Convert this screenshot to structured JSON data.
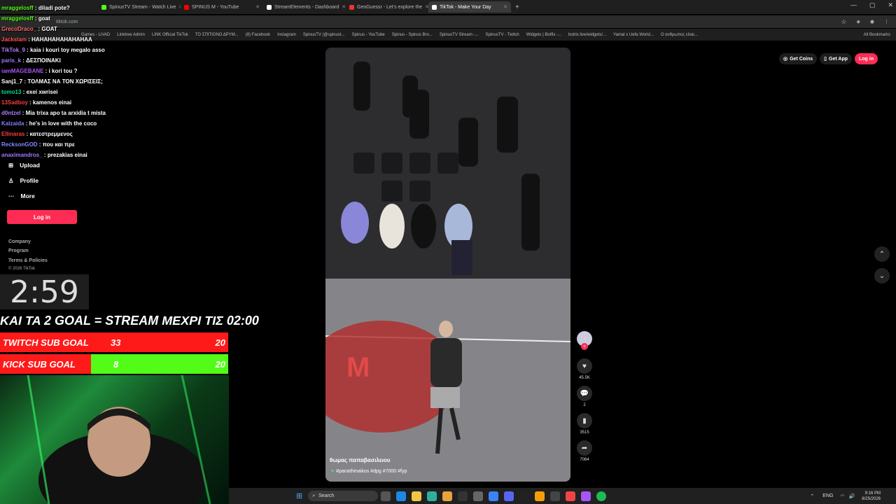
{
  "browser": {
    "tabs": [
      {
        "label": "SpinusTV Stream - Watch Live",
        "color": "#53fc18"
      },
      {
        "label": "SPINUS M - YouTube",
        "color": "#ff0000"
      },
      {
        "label": "StreamElements - Dashboard",
        "color": "#ffffff"
      },
      {
        "label": "GeoGuessr - Let's explore the",
        "color": "#e33"
      },
      {
        "label": "TikTok - Make Your Day",
        "color": "#ffffff"
      }
    ],
    "url": "tiktok.com",
    "bookmarks": [
      "Games - LiVAD",
      "Linktree Admin",
      "LINK Official TikTok",
      "ΤΟ ΣΠΙΤΙΟΝΟ ΔΡΥΜ...",
      "(8) Facebook",
      "Instagram",
      "SpinusTV (@spinust...",
      "Spinus - YouTube",
      "Spinus - Spinus Bro...",
      "SpinusTV Stream -...",
      "SpinusTV - Twitch",
      "Widgets | Botfix -...",
      "botrix.live/widgets/...",
      "Yamal x Uefa World...",
      "Ο ανθρωπος είναι...",
      "All Bookmarks"
    ]
  },
  "chat": [
    {
      "user": "mraggelosff",
      "text": "diladi pote?",
      "color": "#53fc18"
    },
    {
      "user": "mraggelosff",
      "text": "goat",
      "color": "#53fc18"
    },
    {
      "user": "GrecoDraco_",
      "text": "GOAT",
      "color": "#ff6b6b"
    },
    {
      "user": "Jackslam",
      "text": "HAHAHAHAHAHAHAA",
      "color": "#ff4d4d"
    },
    {
      "user": "TikTok_9",
      "text": "kaia i kouri toy megalo asso",
      "color": "#b07cff"
    },
    {
      "user": "paris_k",
      "text": "ΔΕΣΠΟΙΝΑΚΙ",
      "color": "#9f7aff"
    },
    {
      "user": "iamMAGEBANE",
      "text": "i kori tou ?",
      "color": "#a855f7"
    },
    {
      "user": "Sanj1_7",
      "text": "ΤΟΛΜΑΣ ΝΑ ΤΟΝ ΧΩΡΙΣΕΙΣ;",
      "color": "#ffffff"
    },
    {
      "user": "tomo13",
      "text": "exei xwrisei",
      "color": "#00e08a"
    },
    {
      "user": "13Sadboy",
      "text": "kamenos einai",
      "color": "#ff3b3b"
    },
    {
      "user": "d0ntzel",
      "text": "Mia trixa apo ta arxidia t mista",
      "color": "#b07cff"
    },
    {
      "user": "Kalzaida",
      "text": "he's in love with the coco",
      "color": "#8a7cff"
    },
    {
      "user": "Ellinaras",
      "text": "κατεστρεμμενος",
      "color": "#ff3b3b"
    },
    {
      "user": "RecksonGOD",
      "text": "που και πρε",
      "color": "#7c8cff"
    },
    {
      "user": "anaximandros_",
      "text": "prezakias einai",
      "color": "#9f7aff"
    }
  ],
  "sidebar": {
    "items": [
      {
        "label": "Upload",
        "icon": "plus-square-icon"
      },
      {
        "label": "Profile",
        "icon": "person-icon"
      },
      {
        "label": "More",
        "icon": "more-dots-icon"
      }
    ],
    "login_label": "Log in",
    "footer": [
      "Company",
      "Program",
      "Terms & Policies",
      "© 2026 TikTok"
    ]
  },
  "overlay": {
    "timer": "2:59",
    "goal_text": "ΚΑΙ ΤΑ 2 GOAL = STREAM ΜΕΧΡΙ ΤΙΣ 02:00",
    "twitch_goal": {
      "label": "TWITCH SUB GOAL",
      "current": "33",
      "target": "20",
      "progress": 1.0
    },
    "kick_goal": {
      "label": "KICK SUB GOAL",
      "current": "8",
      "target": "20",
      "progress": 0.4
    }
  },
  "video": {
    "author": "θωμας παπαβασιλειου",
    "caption": "#panathinaikos #dpg #7000  #fyp"
  },
  "actions": {
    "likes": "45.5K",
    "comments": "2",
    "saves": "3515",
    "shares": "7064"
  },
  "topright": {
    "coins": "Get Coins",
    "app": "Get App",
    "login": "Log in"
  },
  "taskbar": {
    "search": "Search",
    "lang": "ENG",
    "time": "9:16 PM",
    "date": "8/25/2026"
  }
}
